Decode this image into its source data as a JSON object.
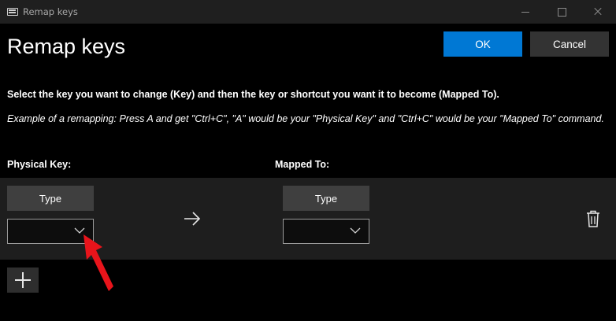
{
  "window": {
    "title": "Remap keys",
    "icons": {
      "app": "keyboard-icon",
      "minimize": "minimize-icon",
      "maximize": "maximize-icon",
      "close": "close-icon"
    }
  },
  "header": {
    "title": "Remap keys",
    "ok_label": "OK",
    "cancel_label": "Cancel"
  },
  "instructions": {
    "main": "Select the key you want to change (Key) and then the key or shortcut you want it to become (Mapped To).",
    "example": "Example of a remapping: Press A and get \"Ctrl+C\", \"A\" would be your \"Physical Key\" and \"Ctrl+C\" would be your \"Mapped To\" command."
  },
  "columns": {
    "physical_key": "Physical Key:",
    "mapped_to": "Mapped To:"
  },
  "rows": [
    {
      "physical": {
        "type_label": "Type",
        "selected_value": ""
      },
      "mapped": {
        "type_label": "Type",
        "selected_value": ""
      },
      "arrow_icon": "arrow-right-icon",
      "delete_icon": "trash-icon"
    }
  ],
  "add_button_icon": "plus-icon",
  "colors": {
    "accent": "#0078d4",
    "background": "#000000",
    "row_background": "#1e1e1e",
    "annotation_arrow": "#e8141b"
  }
}
